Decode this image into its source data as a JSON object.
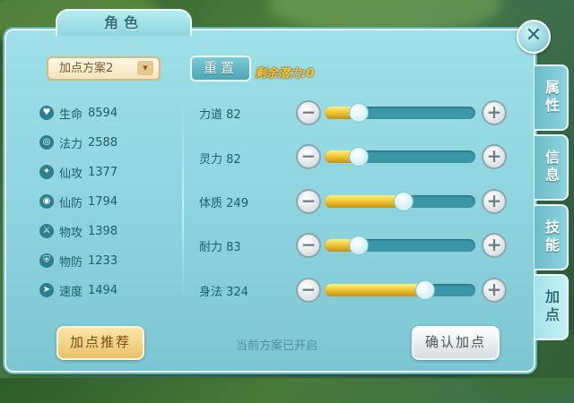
{
  "window": {
    "title": "角色",
    "close_glyph": "✕"
  },
  "side_tabs": [
    {
      "label": "属性",
      "active": false
    },
    {
      "label": "信息",
      "active": false
    },
    {
      "label": "技能",
      "active": false
    },
    {
      "label": "加点",
      "active": true
    }
  ],
  "toolbar": {
    "scheme_selected": "加点方案2",
    "scheme_chevron": "▾",
    "reset_label": "重置",
    "remaining_label": "剩余潜力:",
    "remaining_value": "0"
  },
  "stats": [
    {
      "icon": "heart-icon",
      "glyph": "♥",
      "label": "生命",
      "value": "8594"
    },
    {
      "icon": "mana-swirl-icon",
      "glyph": "◎",
      "label": "法力",
      "value": "2588"
    },
    {
      "icon": "magic-attack-icon",
      "glyph": "✦",
      "label": "仙攻",
      "value": "1377"
    },
    {
      "icon": "magic-defense-icon",
      "glyph": "◉",
      "label": "仙防",
      "value": "1794"
    },
    {
      "icon": "sword-icon",
      "glyph": "⚔",
      "label": "物攻",
      "value": "1398"
    },
    {
      "icon": "shield-icon",
      "glyph": "⛨",
      "label": "物防",
      "value": "1233"
    },
    {
      "icon": "speed-icon",
      "glyph": "➤",
      "label": "速度",
      "value": "1494"
    }
  ],
  "attributes": [
    {
      "label": "力道",
      "value": "82",
      "fill": 0.22
    },
    {
      "label": "灵力",
      "value": "82",
      "fill": 0.22
    },
    {
      "label": "体质",
      "value": "249",
      "fill": 0.52
    },
    {
      "label": "耐力",
      "value": "83",
      "fill": 0.22
    },
    {
      "label": "身法",
      "value": "324",
      "fill": 0.66
    }
  ],
  "buttons": {
    "minus_glyph": "−",
    "plus_glyph": "+"
  },
  "footer": {
    "recommend_label": "加点推荐",
    "status_text": "当前方案已开启",
    "confirm_label": "确认加点"
  },
  "colors": {
    "accent": "#8dd3de",
    "gold": "#f7c93b",
    "track": "#3a97a8"
  }
}
